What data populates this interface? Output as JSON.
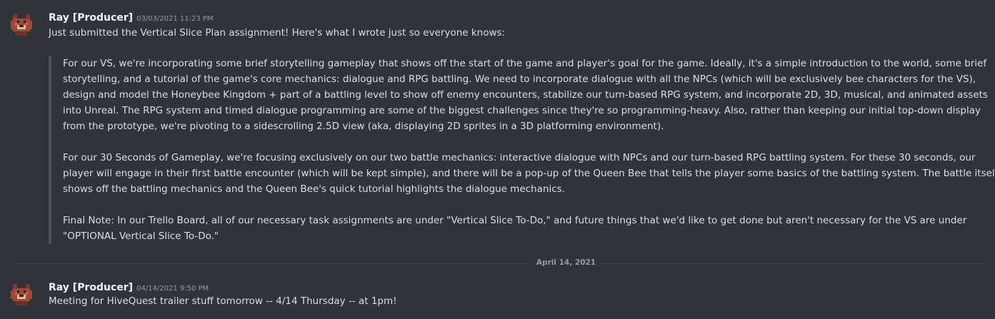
{
  "messages": [
    {
      "author": "Ray [Producer]",
      "timestamp": "03/03/2021 11:23 PM",
      "text": "Just submitted the Vertical Slice Plan assignment! Here's what I wrote just so everyone knows:",
      "quote_lines": [
        "For our VS, we're incorporating some brief storytelling gameplay that shows off the start of the game and player's goal for the game. Ideally, it's a simple introduction to the world, some brief",
        "storytelling, and a tutorial of the game's core mechanics: dialogue and RPG battling. We need to incorporate dialogue with all the NPCs (which will be exclusively bee characters for the VS),",
        "design and model the Honeybee Kingdom + part of a battling level to show off enemy encounters, stabilize our turn-based RPG system, and incorporate 2D, 3D, musical, and animated assets",
        "into Unreal. The RPG system and timed dialogue programming are some of the biggest challenges since they're so programming-heavy. Also, rather than keeping our initial top-down display",
        "from the prototype, we're pivoting to a sidescrolling 2.5D view (aka, displaying 2D sprites in a 3D platforming environment).",
        "For our 30 Seconds of Gameplay, we're focusing exclusively on our two battle mechanics: interactive dialogue with NPCs and our turn-based RPG battling system. For these 30 seconds, our",
        "player will engage in their first battle encounter (which will be kept simple), and there will be a pop-up of the Queen Bee that tells the player some basics of the battling system. The battle itself",
        "shows off the battling mechanics and the Queen Bee's quick tutorial highlights the dialogue mechanics.",
        "Final Note: In our Trello Board, all of our necessary task assignments are under \"Vertical Slice To-Do,\" and future things that we'd like to get done but aren't necessary for the VS are under",
        "\"OPTIONAL Vertical Slice To-Do.\""
      ]
    },
    {
      "author": "Ray [Producer]",
      "timestamp": "04/14/2021 9:50 PM",
      "text": "Meeting for HiveQuest trailer stuff tomorrow -- 4/14 Thursday -- at 1pm!"
    }
  ],
  "date_divider": "April 14, 2021",
  "avatar_icon": "pixel-bear-avatar-icon",
  "colors": {
    "background": "#313338",
    "username": "#f2f3f5",
    "timestamp": "#949ba4",
    "quote_bar": "#4e5058"
  }
}
